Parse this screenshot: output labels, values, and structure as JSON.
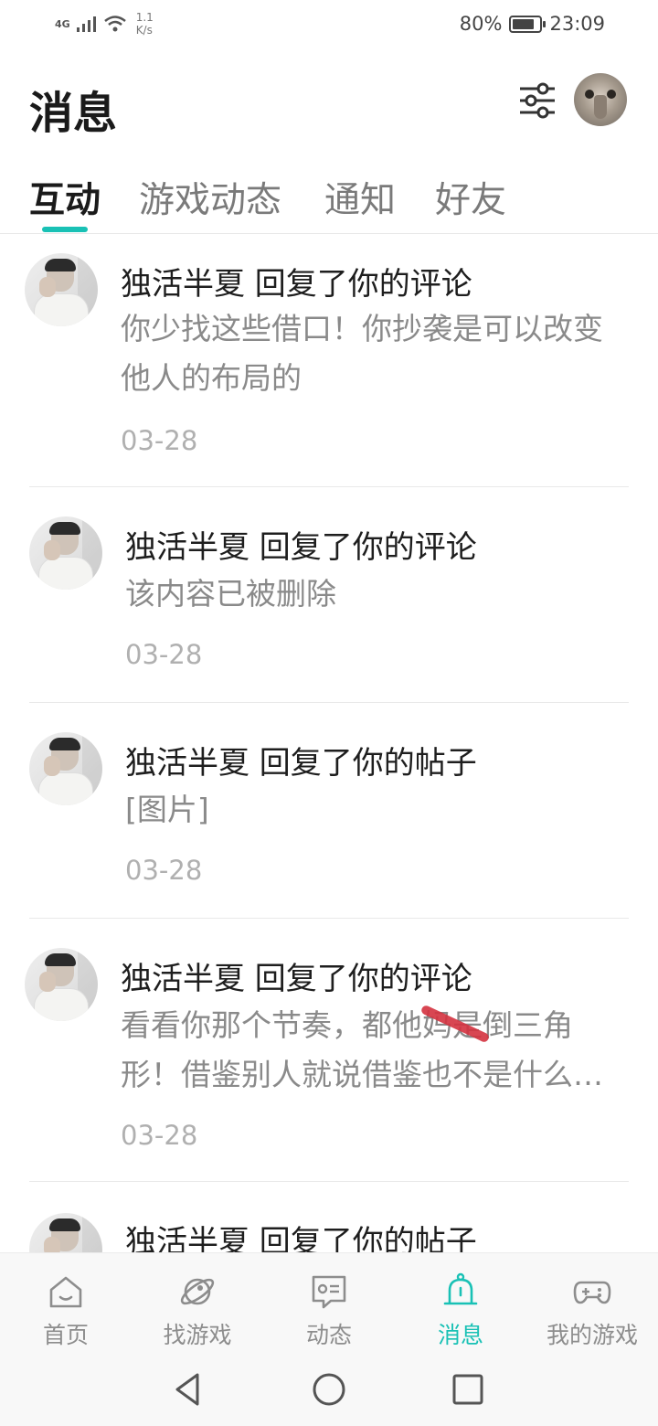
{
  "status_bar": {
    "network": "4G",
    "speed": "1.1\nK/s",
    "battery": "80%",
    "battery_level": 0.8,
    "time": "23:09"
  },
  "header": {
    "title": "消息"
  },
  "tabs": [
    {
      "label": "互动",
      "active": true
    },
    {
      "label": "游戏动态",
      "active": false
    },
    {
      "label": "通知",
      "active": false
    },
    {
      "label": "好友",
      "active": false
    }
  ],
  "messages": [
    {
      "title": "独活半夏 回复了你的评论",
      "content": "你少找这些借口！你抄袭是可以改变他人的布局的",
      "date": "03-28"
    },
    {
      "title": "独活半夏 回复了你的评论",
      "content": "该内容已被删除",
      "date": "03-28"
    },
    {
      "title": "独活半夏 回复了你的帖子",
      "content": "[图片]",
      "date": "03-28"
    },
    {
      "title": "独活半夏 回复了你的评论",
      "content": "看看你那个节奏，都他妈是倒三角形！借鉴别人就说借鉴也不是什么…",
      "date": "03-28"
    },
    {
      "title": "独活半夏 回复了你的帖子",
      "content": "",
      "date": ""
    }
  ],
  "bottom_nav": [
    {
      "label": "首页",
      "icon": "home-icon",
      "active": false
    },
    {
      "label": "找游戏",
      "icon": "planet-icon",
      "active": false
    },
    {
      "label": "动态",
      "icon": "chat-card-icon",
      "active": false
    },
    {
      "label": "消息",
      "icon": "bell-icon",
      "active": true
    },
    {
      "label": "我的游戏",
      "icon": "gamepad-icon",
      "active": false
    }
  ],
  "colors": {
    "accent": "#19c1b5",
    "text_primary": "#1e1e1e",
    "text_secondary": "#8a8a8a",
    "text_date": "#b0b0b0"
  }
}
